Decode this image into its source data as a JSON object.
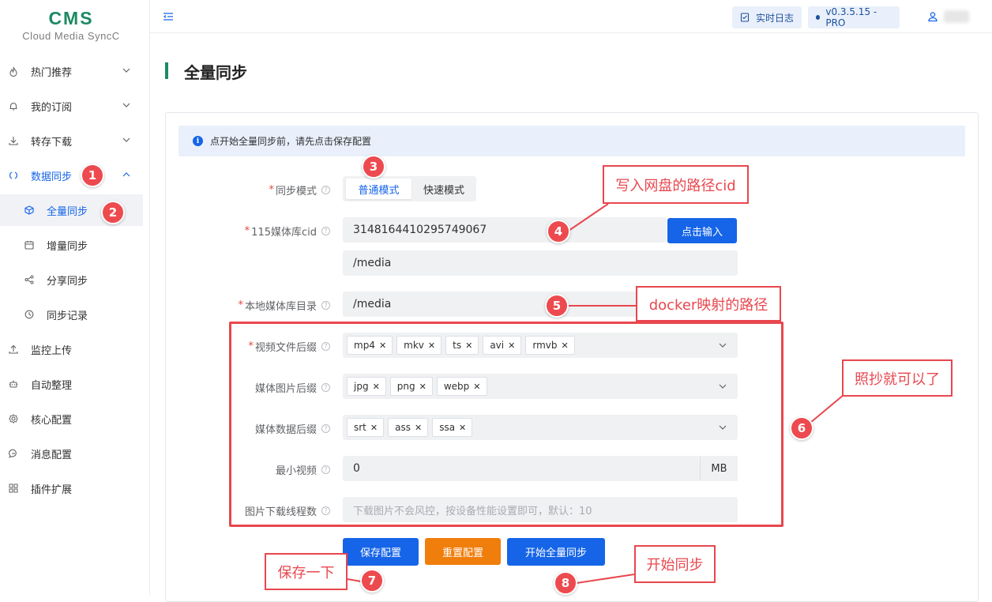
{
  "app": {
    "brand": "CMS",
    "subtitle": "Cloud Media SyncC"
  },
  "header": {
    "log_button": "实时日志",
    "version": "v0.3.5.15 - PRO"
  },
  "sidebar": {
    "items": [
      {
        "label": "热门推荐",
        "icon": "fire-icon"
      },
      {
        "label": "我的订阅",
        "icon": "bell-icon"
      },
      {
        "label": "转存下载",
        "icon": "download-icon"
      },
      {
        "label": "数据同步",
        "icon": "sync-icon"
      },
      {
        "label": "监控上传",
        "icon": "upload-icon"
      },
      {
        "label": "自动整理",
        "icon": "robot-icon"
      },
      {
        "label": "核心配置",
        "icon": "gear-icon"
      },
      {
        "label": "消息配置",
        "icon": "chat-icon"
      },
      {
        "label": "插件扩展",
        "icon": "grid-icon"
      }
    ],
    "sub_items": [
      {
        "label": "全量同步",
        "icon": "cube-icon"
      },
      {
        "label": "增量同步",
        "icon": "calendar-icon"
      },
      {
        "label": "分享同步",
        "icon": "share-icon"
      },
      {
        "label": "同步记录",
        "icon": "history-icon"
      }
    ]
  },
  "page": {
    "title": "全量同步"
  },
  "alert": {
    "text": "点开始全量同步前，请先点击保存配置"
  },
  "form": {
    "sync_mode": {
      "label": "同步模式",
      "options": [
        "普通模式",
        "快速模式"
      ],
      "selected": "普通模式"
    },
    "cid": {
      "label": "115媒体库cid",
      "value": "3148164410295749067",
      "button": "点击输入",
      "path": "/media"
    },
    "local_dir": {
      "label": "本地媒体库目录",
      "value": "/media"
    },
    "video_ext": {
      "label": "视频文件后缀",
      "tags": [
        "mp4",
        "mkv",
        "ts",
        "avi",
        "rmvb"
      ]
    },
    "image_ext": {
      "label": "媒体图片后缀",
      "tags": [
        "jpg",
        "png",
        "webp"
      ]
    },
    "data_ext": {
      "label": "媒体数据后缀",
      "tags": [
        "srt",
        "ass",
        "ssa"
      ]
    },
    "min_video": {
      "label": "最小视频",
      "value": "0",
      "unit": "MB"
    },
    "img_threads": {
      "label": "图片下载线程数",
      "placeholder": "下载图片不会风控，按设备性能设置即可，默认：10"
    }
  },
  "actions": {
    "save": "保存配置",
    "reset": "重置配置",
    "start": "开始全量同步"
  },
  "annotations": {
    "badges": [
      "1",
      "2",
      "3",
      "4",
      "5",
      "6",
      "7",
      "8"
    ],
    "callouts": {
      "cid": "写入网盘的路径cid",
      "docker": "docker映射的路径",
      "copy": "照抄就可以了",
      "save": "保存一下",
      "start": "开始同步"
    }
  },
  "colors": {
    "accent": "#1665e8",
    "brand": "#1d8a63",
    "annotation": "#e8474e",
    "reset": "#f07e0c"
  }
}
